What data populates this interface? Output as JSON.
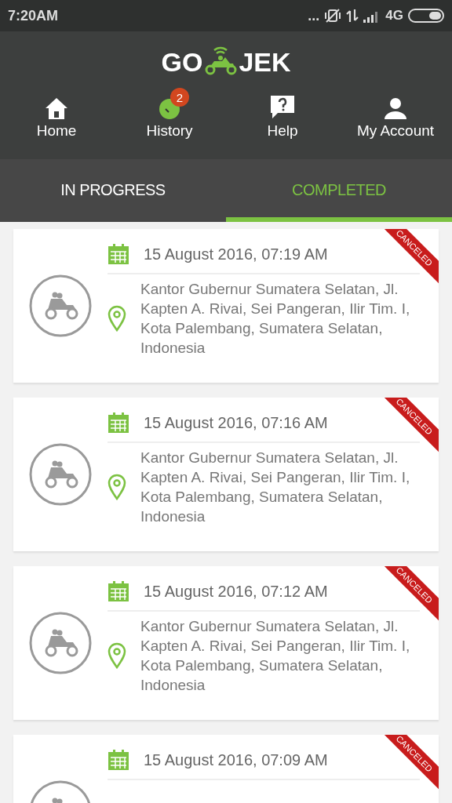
{
  "status_bar": {
    "time": "7:20AM",
    "dots": "...",
    "network": "4G"
  },
  "app_header": {
    "logo_left": "GO",
    "logo_right": "JEK"
  },
  "nav": [
    {
      "label": "Home"
    },
    {
      "label": "History",
      "badge": "2"
    },
    {
      "label": "Help"
    },
    {
      "label": "My Account"
    }
  ],
  "tabs": [
    {
      "label": "IN PROGRESS",
      "selected": false
    },
    {
      "label": "COMPLETED",
      "selected": true
    }
  ],
  "orders": [
    {
      "date": "15 August 2016, 07:19 AM",
      "address": "Kantor Gubernur Sumatera Selatan, Jl. Kapten A. Rivai, Sei Pangeran, Ilir Tim. I, Kota Palembang, Sumatera Selatan, Indonesia",
      "status": "CANCELED"
    },
    {
      "date": "15 August 2016, 07:16 AM",
      "address": "Kantor Gubernur Sumatera Selatan, Jl. Kapten A. Rivai, Sei Pangeran, Ilir Tim. I, Kota Palembang, Sumatera Selatan, Indonesia",
      "status": "CANCELED"
    },
    {
      "date": "15 August 2016, 07:12 AM",
      "address": "Kantor Gubernur Sumatera Selatan, Jl. Kapten A. Rivai, Sei Pangeran, Ilir Tim. I, Kota Palembang, Sumatera Selatan, Indonesia",
      "status": "CANCELED"
    },
    {
      "date": "15 August 2016, 07:09 AM",
      "status": "CANCELED"
    }
  ]
}
